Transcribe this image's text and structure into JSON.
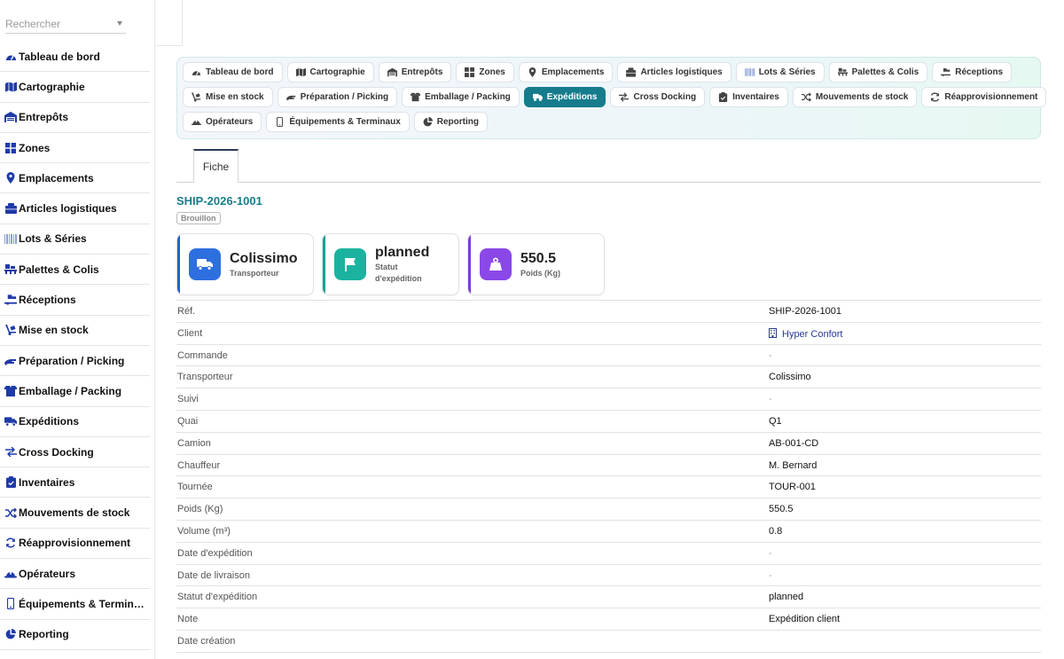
{
  "search": {
    "placeholder": "Rechercher"
  },
  "sidebar": {
    "items": [
      {
        "label": "Tableau de bord",
        "icon": "dashboard-icon"
      },
      {
        "label": "Cartographie",
        "icon": "map-icon"
      },
      {
        "label": "Entrepôts",
        "icon": "warehouse-icon"
      },
      {
        "label": "Zones",
        "icon": "grid-icon"
      },
      {
        "label": "Emplacements",
        "icon": "location-pin-icon"
      },
      {
        "label": "Articles logistiques",
        "icon": "boxes-icon"
      },
      {
        "label": "Lots & Séries",
        "icon": "barcode-icon"
      },
      {
        "label": "Palettes & Colis",
        "icon": "pallet-icon"
      },
      {
        "label": "Réceptions",
        "icon": "truck-ramp-icon"
      },
      {
        "label": "Mise en stock",
        "icon": "dolly-icon"
      },
      {
        "label": "Préparation / Picking",
        "icon": "hand-icon"
      },
      {
        "label": "Emballage / Packing",
        "icon": "box-open-icon"
      },
      {
        "label": "Expéditions",
        "icon": "truck-icon"
      },
      {
        "label": "Cross Docking",
        "icon": "exchange-icon"
      },
      {
        "label": "Inventaires",
        "icon": "clipboard-check-icon"
      },
      {
        "label": "Mouvements de stock",
        "icon": "shuffle-icon"
      },
      {
        "label": "Réapprovisionnement",
        "icon": "refresh-icon"
      },
      {
        "label": "Opérateurs",
        "icon": "hard-hat-icon"
      },
      {
        "label": "Équipements & Terminaux",
        "icon": "mobile-icon"
      },
      {
        "label": "Reporting",
        "icon": "pie-chart-icon"
      }
    ]
  },
  "modnav": {
    "rows": [
      [
        "Tableau de bord",
        "Cartographie",
        "Entrepôts",
        "Zones",
        "Emplacements",
        "Articles logistiques",
        "Lots & Séries",
        "Palettes & Colis",
        "Réceptions"
      ],
      [
        "Mise en stock",
        "Préparation / Picking",
        "Emballage / Packing",
        "Expéditions",
        "Cross Docking",
        "Inventaires",
        "Mouvements de stock",
        "Réapprovisionnement"
      ],
      [
        "Opérateurs",
        "Équipements & Terminaux",
        "Reporting"
      ]
    ],
    "active": "Expéditions",
    "active_color": "#167c8c"
  },
  "tabs": [
    {
      "label": "Fiche"
    }
  ],
  "record": {
    "ref": "SHIP-2026-1001",
    "status_badge": "Brouillon"
  },
  "cards": [
    {
      "value": "Colissimo",
      "label": "Transporteur",
      "color": "#2563c9",
      "icon": "truck-icon"
    },
    {
      "value": "planned",
      "label": "Statut d'expédition",
      "color": "#16a394",
      "icon": "flag-icon"
    },
    {
      "value": "550.5",
      "label": "Poids (Kg)",
      "color": "#7b3fd9",
      "icon": "weight-icon"
    }
  ],
  "details": [
    {
      "key": "Réf.",
      "value": "SHIP-2026-1001"
    },
    {
      "key": "Client",
      "value": "Hyper Confort",
      "type": "link"
    },
    {
      "key": "Commande",
      "value": "-",
      "type": "dash"
    },
    {
      "key": "Transporteur",
      "value": "Colissimo"
    },
    {
      "key": "Suivi",
      "value": "-",
      "type": "dash"
    },
    {
      "key": "Quai",
      "value": "Q1"
    },
    {
      "key": "Camion",
      "value": "AB-001-CD"
    },
    {
      "key": "Chauffeur",
      "value": "M. Bernard"
    },
    {
      "key": "Tournée",
      "value": "TOUR-001"
    },
    {
      "key": "Poids (Kg)",
      "value": "550.5"
    },
    {
      "key": "Volume (m³)",
      "value": "0.8"
    },
    {
      "key": "Date d'expédition",
      "value": "-",
      "type": "dash"
    },
    {
      "key": "Date de livraison",
      "value": "-",
      "type": "dash"
    },
    {
      "key": "Statut d'expédition",
      "value": "planned"
    },
    {
      "key": "Note",
      "value": "Expédition client"
    },
    {
      "key": "Date création",
      "value": ""
    }
  ]
}
